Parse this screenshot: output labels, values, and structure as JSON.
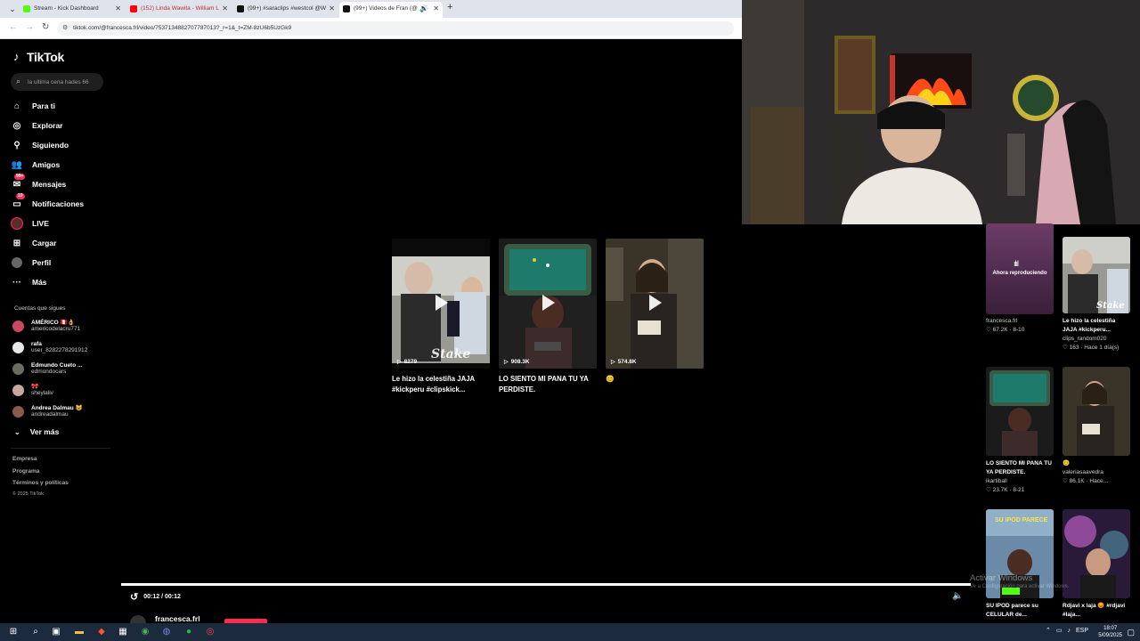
{
  "browser": {
    "tabs": [
      {
        "title": "Stream - Kick Dashboard",
        "favicon_color": "#53fc18"
      },
      {
        "title": "(152) Linda Wawita - William L",
        "favicon_color": "#ff0000"
      },
      {
        "title": "(99+) #saraclips #westcol @W",
        "favicon_color": "#111111"
      },
      {
        "title": "(99+) Videos de Fran (@fra",
        "favicon_color": "#111111"
      }
    ],
    "url": "tiktok.com/@francesca.frl/video/7537134882707787013?_r=1&_t=ZM-8zU6b5UzGk9"
  },
  "tiktok": {
    "logo": "TikTok",
    "search_placeholder": "la ultima cena hades 66",
    "nav": [
      {
        "label": "Para ti",
        "icon": "home-icon"
      },
      {
        "label": "Explorar",
        "icon": "compass-icon"
      },
      {
        "label": "Siguiendo",
        "icon": "following-icon"
      },
      {
        "label": "Amigos",
        "icon": "friends-icon"
      },
      {
        "label": "Mensajes",
        "icon": "messages-icon",
        "badge": "99+"
      },
      {
        "label": "Notificaciones",
        "icon": "notifications-icon",
        "badge": "10"
      },
      {
        "label": "LIVE",
        "icon": "live-icon"
      },
      {
        "label": "Cargar",
        "icon": "upload-icon"
      },
      {
        "label": "Perfil",
        "icon": "profile-icon"
      },
      {
        "label": "Más",
        "icon": "more-icon"
      }
    ],
    "following_title": "Cuentas que sigues",
    "following": [
      {
        "name": "AMÉRICO 🇵🇪👌",
        "user": "americodelacru771",
        "color": "#c94a5e"
      },
      {
        "name": "rafa",
        "user": "user_8282278291912",
        "color": "#e8e8e8"
      },
      {
        "name": "Edmundo Cueto ...",
        "user": "edmundocars",
        "color": "#6d6d5d"
      },
      {
        "name": "🎀",
        "user": "sheylaliv",
        "color": "#c9a7a0"
      },
      {
        "name": "Andrea Dalmau 😺",
        "user": "andreadalmau",
        "color": "#8a5a4a"
      }
    ],
    "ver_mas": "Ver más",
    "footer": [
      "Empresa",
      "Programa",
      "Términos y políticas"
    ],
    "copyright": "© 2025 TikTok"
  },
  "grid": [
    {
      "views": "8279",
      "title": "Le hizo la celestiña JAJA #kickperu #clipskick...",
      "watermark": "Stake"
    },
    {
      "views": "908.3K",
      "title": "LO SIENTO MI PANA TU YA PERDISTE.",
      "watermark": ""
    },
    {
      "views": "574.8K",
      "title": "😊",
      "watermark": ""
    }
  ],
  "recs": [
    {
      "now_playing": "Ahora reproduciendo",
      "user": "francesca.frl",
      "likes": "♡ 67.2K",
      "date": "8-10"
    },
    {
      "title": "Le hizo la celestiña JAJA #kickperu...",
      "user": "clips_random020",
      "likes": "♡ 163",
      "date": "Hace 1 día(s)"
    },
    {
      "title": "LO SIENTO MI PANA TU YA PERDISTE.",
      "user": "ikartiball",
      "likes": "♡ 23.7K",
      "date": "8-21"
    },
    {
      "title": "😊",
      "user": "valeriasaavedra",
      "likes": "♡ 86.1K",
      "date": "Hace..."
    },
    {
      "title": "SU IPOD parece su CELULAR de...",
      "user": "",
      "likes": "",
      "date": ""
    },
    {
      "title": "Rdjavi x laja 😡 #rdjavi #laja...",
      "user": "",
      "likes": "",
      "date": ""
    }
  ],
  "player": {
    "time": "00:12 / 00:12",
    "author": "francesca.frl",
    "progress": 1.0
  },
  "windows": {
    "activate_title": "Activar Windows",
    "activate_sub": "Ve a Configuración para activar Windows.",
    "lang": "ESP",
    "time": "18:07",
    "date": "5/09/2025"
  },
  "colors": {
    "accent": "#fe2c55",
    "background": "#000000",
    "taskbar": "#1c2a3e"
  }
}
